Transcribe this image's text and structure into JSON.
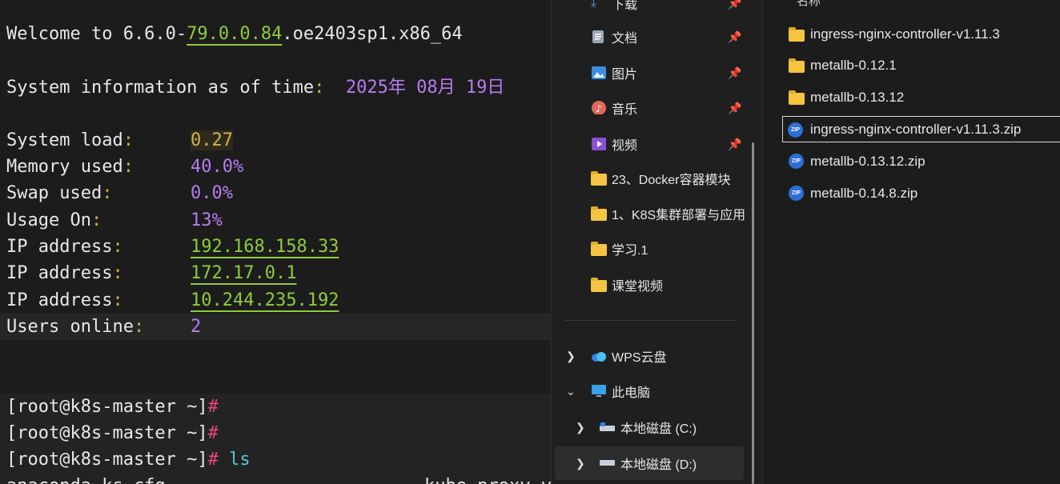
{
  "terminal": {
    "welcome_prefix": "Welcome to 6.6.0-",
    "welcome_version": "79.0.0.84",
    "welcome_suffix": ".oe2403sp1.x86_64",
    "sysinfo_label": "System information as of time",
    "sysinfo_date": "2025年 08月 19日",
    "rows": [
      {
        "label": "System load",
        "value": "0.27"
      },
      {
        "label": "Memory used",
        "value": "40.0%"
      },
      {
        "label": "Swap used",
        "value": "0.0%"
      },
      {
        "label": "Usage On",
        "value": "13%"
      },
      {
        "label": "IP address",
        "value": "192.168.158.33"
      },
      {
        "label": "IP address",
        "value": "172.17.0.1"
      },
      {
        "label": "IP address",
        "value": "10.244.235.192"
      },
      {
        "label": "Users online",
        "value": "2"
      }
    ],
    "prompt": "[root@k8s-master ~]",
    "prompt_hash": "#",
    "command": "ls",
    "partial_left": "anaconda-ks.cfg",
    "partial_right": "kube-proxy.yaml"
  },
  "nav": {
    "top_partial": "下载",
    "items": [
      {
        "label": "文档",
        "icon": "document-icon",
        "pinned": true
      },
      {
        "label": "图片",
        "icon": "picture-icon",
        "pinned": true
      },
      {
        "label": "音乐",
        "icon": "music-icon",
        "pinned": true
      },
      {
        "label": "视频",
        "icon": "video-icon",
        "pinned": true
      },
      {
        "label": "23、Docker容器模块",
        "icon": "folder-icon",
        "pinned": false
      },
      {
        "label": "1、K8S集群部署与应用",
        "icon": "folder-icon",
        "pinned": false
      },
      {
        "label": "学习.1",
        "icon": "folder-icon",
        "pinned": false
      },
      {
        "label": "课堂视频",
        "icon": "folder-icon",
        "pinned": false
      }
    ],
    "wps": "WPS云盘",
    "this_pc": "此电脑",
    "drive_c": "本地磁盘 (C:)",
    "drive_d": "本地磁盘 (D:)"
  },
  "list": {
    "column_header": "名称",
    "files": [
      {
        "name": "ingress-nginx-controller-v1.11.3",
        "type": "folder"
      },
      {
        "name": "metallb-0.12.1",
        "type": "folder"
      },
      {
        "name": "metallb-0.13.12",
        "type": "folder"
      },
      {
        "name": "ingress-nginx-controller-v1.11.3.zip",
        "type": "zip"
      },
      {
        "name": "metallb-0.13.12.zip",
        "type": "zip"
      },
      {
        "name": "metallb-0.14.8.zip",
        "type": "zip"
      }
    ]
  },
  "colors": {
    "terminal_bg": "#1c1c1c",
    "purple": "#b67cf0",
    "green": "#8fcc3a",
    "yellow": "#d6b04a",
    "cyan": "#50c8d8",
    "pink": "#e8477a",
    "folder": "#f5c542",
    "zip": "#2f6fd6"
  }
}
